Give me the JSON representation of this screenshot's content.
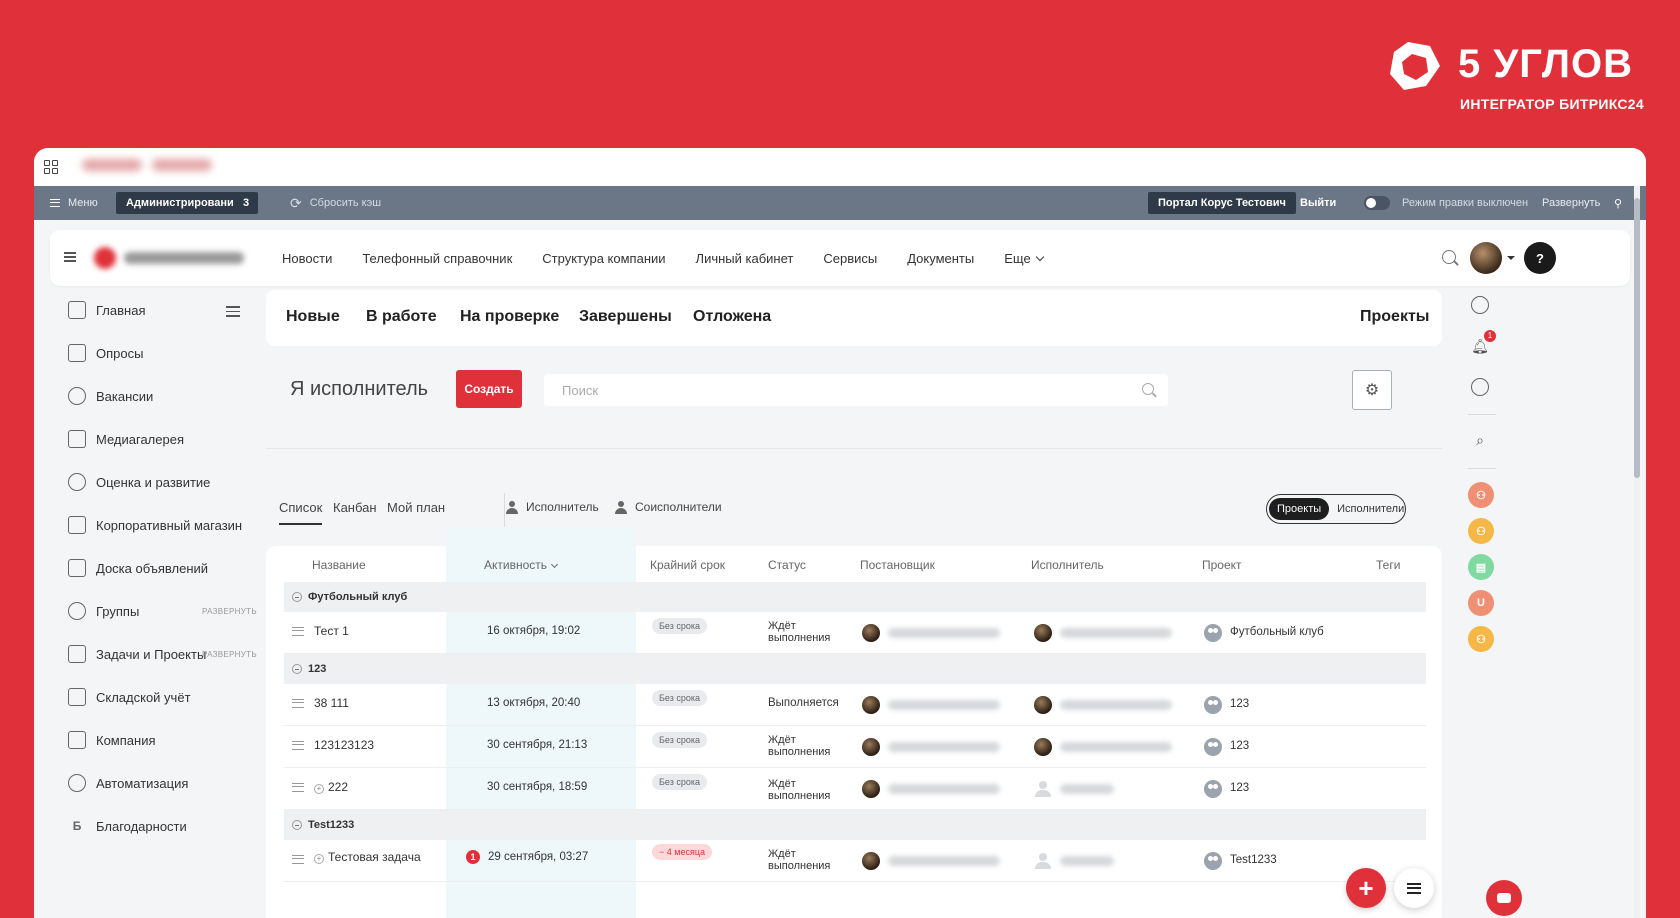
{
  "brand": {
    "title": "5 УГЛОВ",
    "subtitle": "ИНТЕГРАТОР БИТРИКС24",
    "color": "#e0313a"
  },
  "adminbar": {
    "menu": "Меню",
    "admin": "Администрирование",
    "count": "3",
    "clear_cache": "Сбросить кэш",
    "portal": "Портал Корус Тестович",
    "exit": "Выйти",
    "edit_mode": "Режим правки выключен",
    "expand": "Развернуть"
  },
  "nav": {
    "items": [
      "Новости",
      "Телефонный справочник",
      "Структура компании",
      "Личный кабинет",
      "Сервисы",
      "Документы"
    ],
    "more": "Еще",
    "help": "?"
  },
  "sidebar": {
    "items": [
      {
        "label": "Главная",
        "icon": "dashboard-icon"
      },
      {
        "label": "Опросы",
        "icon": "survey-icon"
      },
      {
        "label": "Вакансии",
        "icon": "person-search-icon"
      },
      {
        "label": "Медиагалерея",
        "icon": "gallery-icon"
      },
      {
        "label": "Оценка и развитие",
        "icon": "people-icon"
      },
      {
        "label": "Корпоративный магазин",
        "icon": "cart-icon"
      },
      {
        "label": "Доска объявлений",
        "icon": "board-icon"
      },
      {
        "label": "Группы",
        "icon": "groups-icon",
        "extra": "РАЗВЕРНУТЬ"
      },
      {
        "label": "Задачи и Проекты",
        "icon": "tasks-icon",
        "extra": "РАЗВЕРНУТЬ"
      },
      {
        "label": "Складской учёт",
        "icon": "warehouse-icon"
      },
      {
        "label": "Компания",
        "icon": "company-icon"
      },
      {
        "label": "Автоматизация",
        "icon": "automation-icon"
      },
      {
        "label": "Благодарности",
        "icon": "thanks-icon",
        "letter": "Б"
      }
    ]
  },
  "tabs": {
    "items": [
      "Новые",
      "В работе",
      "На проверке",
      "Завершены",
      "Отложена"
    ],
    "projects": "Проекты"
  },
  "toolbar": {
    "title": "Я исполнитель",
    "create": "Создать",
    "search_placeholder": "Поиск"
  },
  "views": {
    "items": [
      "Список",
      "Канбан",
      "Мой план"
    ],
    "roles": [
      "Исполнитель",
      "Соисполнители"
    ],
    "switch_on": "Проекты",
    "switch_off": "Исполнители"
  },
  "table": {
    "columns": [
      "Название",
      "Активность",
      "Крайний срок",
      "Статус",
      "Постановщик",
      "Исполнитель",
      "Проект",
      "Теги"
    ],
    "groups": [
      {
        "name": "Футбольный клуб",
        "rows": [
          {
            "name": "Тест 1",
            "activity": "16 октября, 19:02",
            "deadline": "Без срока",
            "status": "Ждёт выполнения",
            "project": "Футбольный клуб",
            "ghost": false
          }
        ]
      },
      {
        "name": "123",
        "rows": [
          {
            "name": "38 111",
            "activity": "13 октября, 20:40",
            "deadline": "Без срока",
            "status": "Выполняется",
            "project": "123",
            "ghost": false
          },
          {
            "name": "123123123",
            "activity": "30 сентября, 21:13",
            "deadline": "Без срока",
            "status": "Ждёт выполнения",
            "project": "123",
            "ghost": false
          },
          {
            "name": "222",
            "activity": "30 сентября, 18:59",
            "deadline": "Без срока",
            "status": "Ждёт выполнения",
            "project": "123",
            "ghost": true,
            "plus": true
          }
        ]
      },
      {
        "name": "Test1233",
        "rows": [
          {
            "name": "Тестовая задача",
            "activity": "29 сентября, 03:27",
            "deadline": "− 4 месяца",
            "status": "Ждёт выполнения",
            "project": "Test1233",
            "ghost": true,
            "plus": true,
            "counter": "1",
            "overdue": true
          }
        ]
      }
    ]
  },
  "rail": {
    "notification_count": "1",
    "group_letter": "U"
  }
}
